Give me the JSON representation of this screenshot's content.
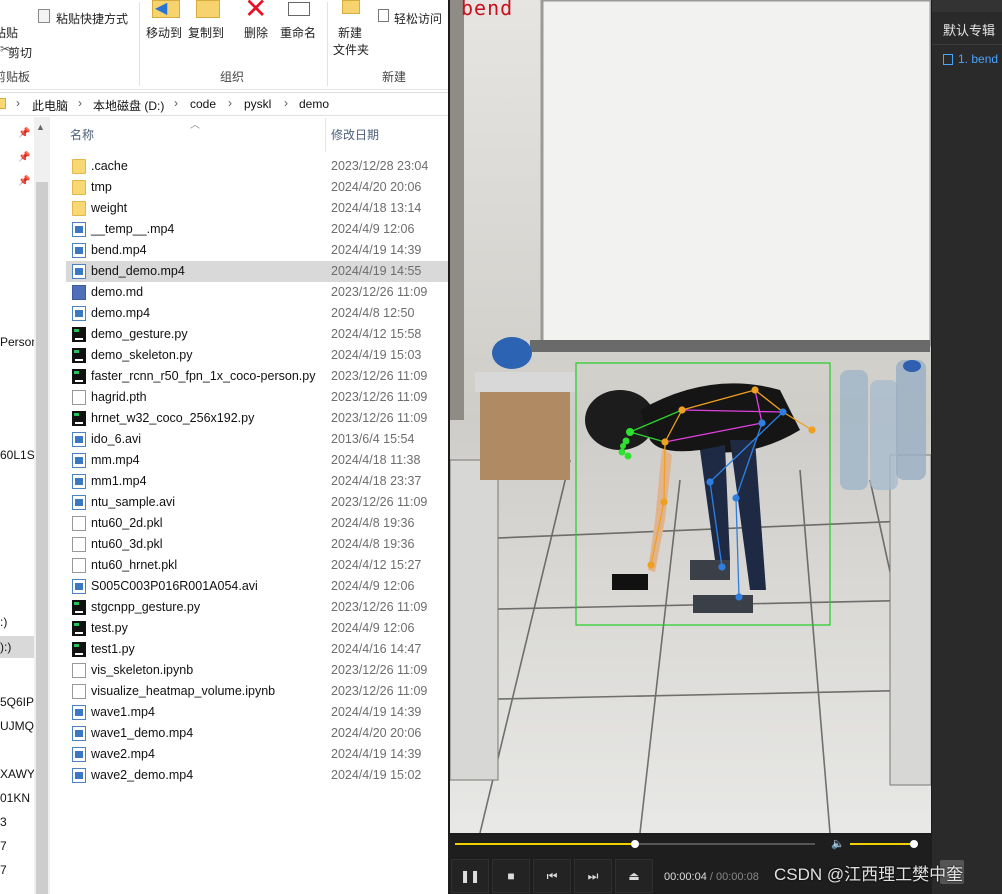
{
  "ribbon": {
    "paste_label": "粘贴",
    "paste_shortcut_label": "粘贴快捷方式",
    "cut_label": "剪切",
    "clipboard_group": "剪贴板",
    "move_to_label": "移动到",
    "copy_to_label": "复制到",
    "delete_label": "删除",
    "rename_label": "重命名",
    "organize_group": "组织",
    "new_folder_line1": "新建",
    "new_folder_line2": "文件夹",
    "easy_access_label": "轻松访问",
    "new_group": "新建"
  },
  "breadcrumb": [
    "此电脑",
    "本地磁盘 (D:)",
    "code",
    "pyskl",
    "demo"
  ],
  "nav_pane": [
    "Person",
    "60L1S",
    ":)",
    "):)",
    "5Q6IP",
    "UJMQ",
    "XAWY",
    "01KN",
    "3",
    "7",
    "7"
  ],
  "columns": {
    "name": "名称",
    "date": "修改日期"
  },
  "files": [
    {
      "name": ".cache",
      "date": "2023/12/28 23:04",
      "icon": "folder-icon"
    },
    {
      "name": "tmp",
      "date": "2024/4/20 20:06",
      "icon": "folder-icon"
    },
    {
      "name": "weight",
      "date": "2024/4/18 13:14",
      "icon": "folder-icon"
    },
    {
      "name": "__temp__.mp4",
      "date": "2024/4/9 12:06",
      "icon": "video-file-icon"
    },
    {
      "name": "bend.mp4",
      "date": "2024/4/19 14:39",
      "icon": "video-file-icon"
    },
    {
      "name": "bend_demo.mp4",
      "date": "2024/4/19 14:55",
      "icon": "video-file-icon",
      "selected": true
    },
    {
      "name": "demo.md",
      "date": "2023/12/26 11:09",
      "icon": "markdown-file-icon"
    },
    {
      "name": "demo.mp4",
      "date": "2024/4/8 12:50",
      "icon": "video-file-icon"
    },
    {
      "name": "demo_gesture.py",
      "date": "2024/4/12 15:58",
      "icon": "pycharm-file-icon"
    },
    {
      "name": "demo_skeleton.py",
      "date": "2024/4/19 15:03",
      "icon": "pycharm-file-icon"
    },
    {
      "name": "faster_rcnn_r50_fpn_1x_coco-person.py",
      "date": "2023/12/26 11:09",
      "icon": "pycharm-file-icon"
    },
    {
      "name": "hagrid.pth",
      "date": "2023/12/26 11:09",
      "icon": "generic-file-icon"
    },
    {
      "name": "hrnet_w32_coco_256x192.py",
      "date": "2023/12/26 11:09",
      "icon": "pycharm-file-icon"
    },
    {
      "name": "ido_6.avi",
      "date": "2013/6/4 15:54",
      "icon": "video-file-icon"
    },
    {
      "name": "mm.mp4",
      "date": "2024/4/18 11:38",
      "icon": "video-file-icon"
    },
    {
      "name": "mm1.mp4",
      "date": "2024/4/18 23:37",
      "icon": "video-file-icon"
    },
    {
      "name": "ntu_sample.avi",
      "date": "2023/12/26 11:09",
      "icon": "video-file-icon"
    },
    {
      "name": "ntu60_2d.pkl",
      "date": "2024/4/8 19:36",
      "icon": "generic-file-icon"
    },
    {
      "name": "ntu60_3d.pkl",
      "date": "2024/4/8 19:36",
      "icon": "generic-file-icon"
    },
    {
      "name": "ntu60_hrnet.pkl",
      "date": "2024/4/12 15:27",
      "icon": "generic-file-icon"
    },
    {
      "name": "S005C003P016R001A054.avi",
      "date": "2024/4/9 12:06",
      "icon": "video-file-icon"
    },
    {
      "name": "stgcnpp_gesture.py",
      "date": "2023/12/26 11:09",
      "icon": "pycharm-file-icon"
    },
    {
      "name": "test.py",
      "date": "2024/4/9 12:06",
      "icon": "pycharm-file-icon"
    },
    {
      "name": "test1.py",
      "date": "2024/4/16 14:47",
      "icon": "pycharm-file-icon"
    },
    {
      "name": "vis_skeleton.ipynb",
      "date": "2023/12/26 11:09",
      "icon": "generic-file-icon"
    },
    {
      "name": "visualize_heatmap_volume.ipynb",
      "date": "2023/12/26 11:09",
      "icon": "generic-file-icon"
    },
    {
      "name": "wave1.mp4",
      "date": "2024/4/19 14:39",
      "icon": "video-file-icon"
    },
    {
      "name": "wave1_demo.mp4",
      "date": "2024/4/20 20:06",
      "icon": "video-file-icon"
    },
    {
      "name": "wave2.mp4",
      "date": "2024/4/19 14:39",
      "icon": "video-file-icon"
    },
    {
      "name": "wave2_demo.mp4",
      "date": "2024/4/19 15:02",
      "icon": "video-file-icon"
    }
  ],
  "player": {
    "action_label": "bend",
    "current_time": "00:00:04",
    "time_separator": "/",
    "total_time": "00:00:08",
    "progress": 0.5,
    "volume": 1.0,
    "accent_color": "#f0d000",
    "bbox_color": "#22cc22"
  },
  "playlist": {
    "title": "默认专辑",
    "item": "1. bend"
  },
  "watermark": "CSDN @江西理工樊中奎"
}
